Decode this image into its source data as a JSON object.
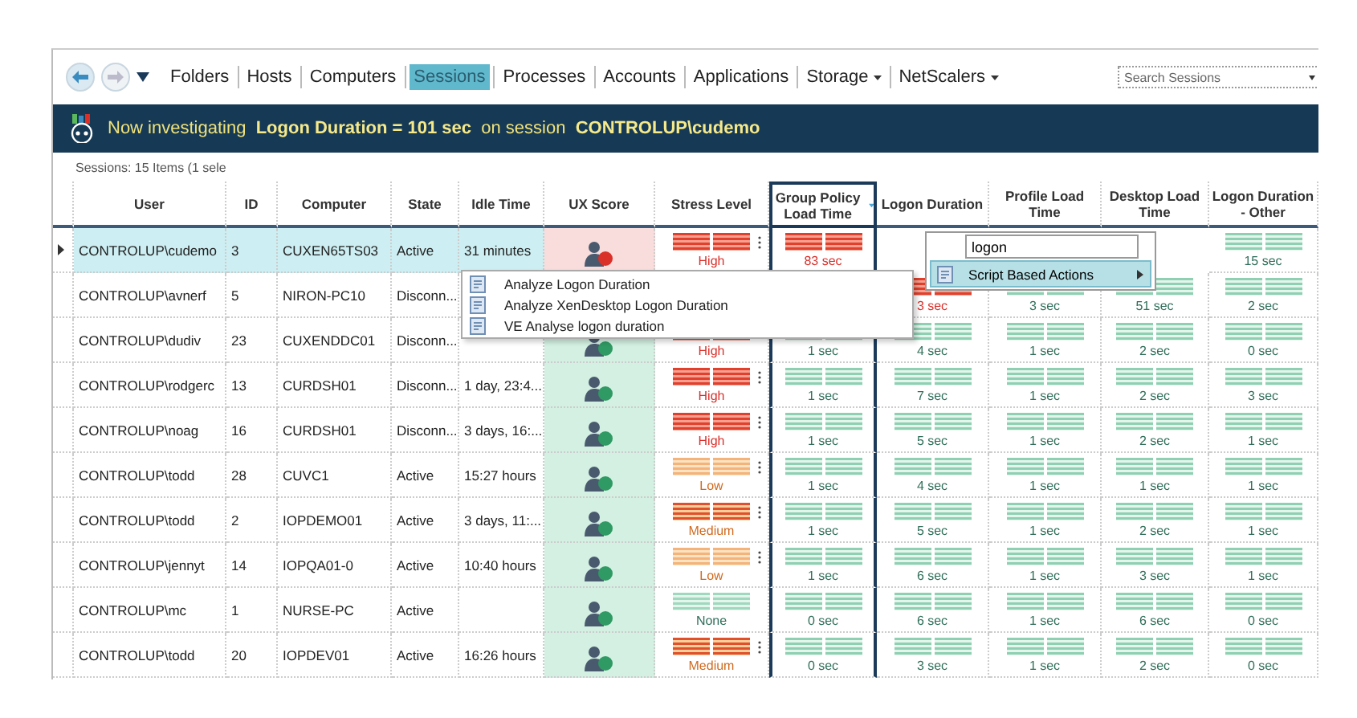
{
  "nav": {
    "tabs": [
      {
        "label": "Folders",
        "selected": false,
        "dropdown": false
      },
      {
        "label": "Hosts",
        "selected": false,
        "dropdown": false
      },
      {
        "label": "Computers",
        "selected": false,
        "dropdown": false
      },
      {
        "label": "Sessions",
        "selected": true,
        "dropdown": false
      },
      {
        "label": "Processes",
        "selected": false,
        "dropdown": false
      },
      {
        "label": "Accounts",
        "selected": false,
        "dropdown": false
      },
      {
        "label": "Applications",
        "selected": false,
        "dropdown": false
      },
      {
        "label": "Storage",
        "selected": false,
        "dropdown": true
      },
      {
        "label": "NetScalers",
        "selected": false,
        "dropdown": true
      }
    ],
    "search": {
      "placeholder": "Search Sessions"
    }
  },
  "banner": "Now investigating  **Logon Duration = 101 sec**  on session  **CONTROLUP\\cudemo**",
  "summary": "Sessions: 15 Items (1 sele",
  "columns": [
    {
      "label": "User",
      "sorted": false
    },
    {
      "label": "ID",
      "sorted": false
    },
    {
      "label": "Computer",
      "sorted": false
    },
    {
      "label": "State",
      "sorted": false
    },
    {
      "label": "Idle Time",
      "sorted": false
    },
    {
      "label": "UX Score",
      "sorted": false
    },
    {
      "label": "Stress Level",
      "sorted": false
    },
    {
      "label": "Group Policy Load Time",
      "sorted": true
    },
    {
      "label": "Logon Duration",
      "sorted": false
    },
    {
      "label": "Profile Load Time",
      "sorted": false
    },
    {
      "label": "Desktop Load Time",
      "sorted": false
    },
    {
      "label": "Logon Duration - Other",
      "sorted": false
    }
  ],
  "rows": [
    {
      "selected": true,
      "user": "CONTROLUP\\cudemo",
      "id": "3",
      "computer": "CUXEN65TS03",
      "state": "Active",
      "idle": "31 minutes",
      "ux": {
        "color": "#d9302a"
      },
      "stress": {
        "label": "High",
        "kind": "high"
      },
      "metrics": {
        "gp": {
          "text": "83 sec",
          "alert": true
        },
        "other": {
          "text": "15 sec",
          "alert": false
        }
      }
    },
    {
      "selected": false,
      "user": "CONTROLUP\\avnerf",
      "id": "5",
      "computer": "NIRON-PC10",
      "state": "Disconn...",
      "metrics": {
        "logon": {
          "text": "3 sec",
          "alert": true
        },
        "profile": {
          "text": "3 sec",
          "alert": false
        },
        "desktop": {
          "text": "51 sec",
          "alert": false
        },
        "other": {
          "text": "2 sec",
          "alert": false
        }
      }
    },
    {
      "selected": false,
      "user": "CONTROLUP\\dudiv",
      "id": "23",
      "computer": "CUXENDDC01",
      "state": "Disconn...",
      "ux": {
        "color": "#2f9a63"
      },
      "stress": {
        "label": "High",
        "kind": "high"
      },
      "metrics": {
        "gp": {
          "text": "1 sec",
          "alert": false
        },
        "logon": {
          "text": "4 sec",
          "alert": false
        },
        "profile": {
          "text": "1 sec",
          "alert": false
        },
        "desktop": {
          "text": "2 sec",
          "alert": false
        },
        "other": {
          "text": "0 sec",
          "alert": false
        }
      }
    },
    {
      "selected": false,
      "user": "CONTROLUP\\rodgerc",
      "id": "13",
      "computer": "CURDSH01",
      "state": "Disconn...",
      "idle": "1 day, 23:4...",
      "ux": {
        "color": "#2f9a63"
      },
      "stress": {
        "label": "High",
        "kind": "high"
      },
      "metrics": {
        "gp": {
          "text": "1 sec",
          "alert": false
        },
        "logon": {
          "text": "7 sec",
          "alert": false
        },
        "profile": {
          "text": "1 sec",
          "alert": false
        },
        "desktop": {
          "text": "2 sec",
          "alert": false
        },
        "other": {
          "text": "3 sec",
          "alert": false
        }
      }
    },
    {
      "selected": false,
      "user": "CONTROLUP\\noag",
      "id": "16",
      "computer": "CURDSH01",
      "state": "Disconn...",
      "idle": "3 days, 16:...",
      "ux": {
        "color": "#2f9a63"
      },
      "stress": {
        "label": "High",
        "kind": "high"
      },
      "metrics": {
        "gp": {
          "text": "1 sec",
          "alert": false
        },
        "logon": {
          "text": "5 sec",
          "alert": false
        },
        "profile": {
          "text": "1 sec",
          "alert": false
        },
        "desktop": {
          "text": "2 sec",
          "alert": false
        },
        "other": {
          "text": "1 sec",
          "alert": false
        }
      }
    },
    {
      "selected": false,
      "user": "CONTROLUP\\todd",
      "id": "28",
      "computer": "CUVC1",
      "state": "Active",
      "idle": "15:27 hours",
      "ux": {
        "color": "#2f9a63"
      },
      "stress": {
        "label": "Low",
        "kind": "low"
      },
      "metrics": {
        "gp": {
          "text": "1 sec",
          "alert": false
        },
        "logon": {
          "text": "4 sec",
          "alert": false
        },
        "profile": {
          "text": "1 sec",
          "alert": false
        },
        "desktop": {
          "text": "1 sec",
          "alert": false
        },
        "other": {
          "text": "1 sec",
          "alert": false
        }
      }
    },
    {
      "selected": false,
      "user": "CONTROLUP\\todd",
      "id": "2",
      "computer": "IOPDEMO01",
      "state": "Active",
      "idle": "3 days, 11:...",
      "ux": {
        "color": "#2f9a63"
      },
      "stress": {
        "label": "Medium",
        "kind": "medium"
      },
      "metrics": {
        "gp": {
          "text": "1 sec",
          "alert": false
        },
        "logon": {
          "text": "5 sec",
          "alert": false
        },
        "profile": {
          "text": "1 sec",
          "alert": false
        },
        "desktop": {
          "text": "2 sec",
          "alert": false
        },
        "other": {
          "text": "1 sec",
          "alert": false
        }
      }
    },
    {
      "selected": false,
      "user": "CONTROLUP\\jennyt",
      "id": "14",
      "computer": "IOPQA01-0",
      "state": "Active",
      "idle": "10:40 hours",
      "ux": {
        "color": "#2f9a63"
      },
      "stress": {
        "label": "Low",
        "kind": "low"
      },
      "metrics": {
        "gp": {
          "text": "1 sec",
          "alert": false
        },
        "logon": {
          "text": "6 sec",
          "alert": false
        },
        "profile": {
          "text": "1 sec",
          "alert": false
        },
        "desktop": {
          "text": "3 sec",
          "alert": false
        },
        "other": {
          "text": "1 sec",
          "alert": false
        }
      }
    },
    {
      "selected": false,
      "user": "CONTROLUP\\mc",
      "id": "1",
      "computer": "NURSE-PC",
      "state": "Active",
      "ux": {
        "color": "#2f9a63"
      },
      "stress": {
        "label": "None",
        "kind": "none"
      },
      "metrics": {
        "gp": {
          "text": "0 sec",
          "alert": false
        },
        "logon": {
          "text": "6 sec",
          "alert": false
        },
        "profile": {
          "text": "1 sec",
          "alert": false
        },
        "desktop": {
          "text": "6 sec",
          "alert": false
        },
        "other": {
          "text": "0 sec",
          "alert": false
        }
      }
    },
    {
      "selected": false,
      "user": "CONTROLUP\\todd",
      "id": "20",
      "computer": "IOPDEV01",
      "state": "Active",
      "idle": "16:26 hours",
      "ux": {
        "color": "#2f9a63"
      },
      "stress": {
        "label": "Medium",
        "kind": "medium"
      },
      "metrics": {
        "gp": {
          "text": "0 sec",
          "alert": false
        },
        "logon": {
          "text": "3 sec",
          "alert": false
        },
        "profile": {
          "text": "1 sec",
          "alert": false
        },
        "desktop": {
          "text": "2 sec",
          "alert": false
        },
        "other": {
          "text": "0 sec",
          "alert": false
        }
      }
    }
  ],
  "context_menu": {
    "items": [
      {
        "label": "Analyze Logon Duration"
      },
      {
        "label": "Analyze XenDesktop Logon Duration"
      },
      {
        "label": "VE Analyse logon duration"
      }
    ]
  },
  "actions_menu": {
    "filter": "logon",
    "items": [
      {
        "label": "Script Based Actions",
        "selected": true,
        "submenu": true
      }
    ]
  }
}
